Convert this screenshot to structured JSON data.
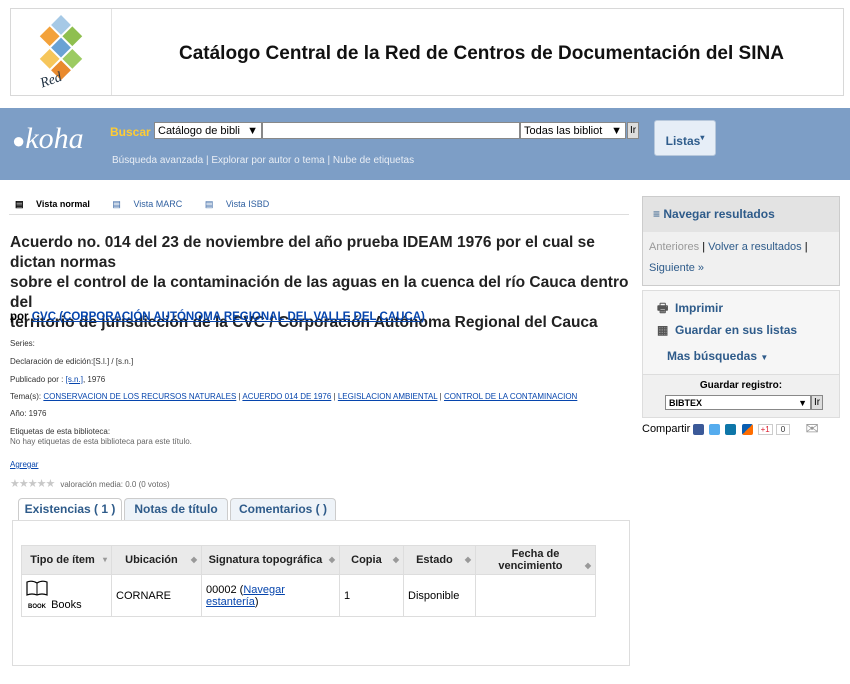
{
  "header": {
    "title": "Catálogo Central de la Red de Centros de Documentación del SINA",
    "logo_text": "Red"
  },
  "search": {
    "logo": "koha",
    "label": "Buscar",
    "catalog_select": "Catálogo de bibli",
    "query_value": "",
    "library_select": "Todas las bibliot",
    "go_label": "Ir",
    "links": [
      "Búsqueda avanzada",
      "Explorar por autor o tema",
      "Nube de etiquetas"
    ],
    "lists_button": "Listas"
  },
  "views": {
    "normal": "Vista normal",
    "marc": "Vista MARC",
    "isbd": "Vista ISBD"
  },
  "record": {
    "title_lines": [
      "Acuerdo no. 014 del 23 de noviembre del año prueba IDEAM 1976 por el cual se dictan normas",
      "sobre el control de la contaminación de las aguas en la cuenca del río Cauca dentro del",
      "territorio de jurisdicción de la CVC / Corporación Autónoma Regional del Cauca"
    ],
    "author_prefix": "por",
    "author": "CVC (CORPORACIÓN AUTÓNOMA REGIONAL DEL VALLE DEL CAUCA)",
    "series": "Series:",
    "edition": "Declaración de edición:[S.l.] / [s.n.]",
    "publisher_label": "Publicado por :",
    "publisher": "[s.n.]",
    "publisher_year": ", 1976",
    "subjects_label": "Tema(s):",
    "subjects": [
      "CONSERVACION DE LOS RECURSOS NATURALES",
      "ACUERDO 014 DE 1976",
      "LEGISLACION AMBIENTAL",
      "CONTROL DE LA CONTAMINACION"
    ],
    "year": "Año: 1976",
    "tags_label": "Etiquetas de esta biblioteca:",
    "tags_none": "No hay etiquetas de esta biblioteca para este título.",
    "add_link": "Agregar",
    "rating_text": "valoración media: 0.0 (0 votos)",
    "rating_value": 0
  },
  "tabs": [
    "Existencias ( 1 )",
    "Notas de título",
    "Comentarios ( )"
  ],
  "holdings": {
    "headers": [
      "Tipo de ítem",
      "Ubicación",
      "Signatura topográfica",
      "Copia",
      "Estado",
      "Fecha de vencimiento"
    ],
    "row": {
      "type_icon_label": "BOOK",
      "type": "Books",
      "location": "CORNARE",
      "callnumber": "00002",
      "shelf_link": "Navegar estantería",
      "copy": "1",
      "status": "Disponible",
      "due": ""
    }
  },
  "sidebar": {
    "browse_title": "Navegar resultados",
    "prev": "Anteriores",
    "back": "Volver a resultados",
    "next": "Siguiente »",
    "print": "Imprimir",
    "save_lists": "Guardar en sus listas",
    "more_searches": "Mas búsquedas",
    "save_record_label": "Guardar registro:",
    "format_select": "BIBTEX",
    "go_label": "Ir",
    "share_label": "Compartir",
    "gplus_label": "+1",
    "gplus_count": "0"
  },
  "colors": {
    "koha_bar": "#7d9ec6",
    "link": "#0645ad",
    "accent": "#2e5b8a"
  }
}
